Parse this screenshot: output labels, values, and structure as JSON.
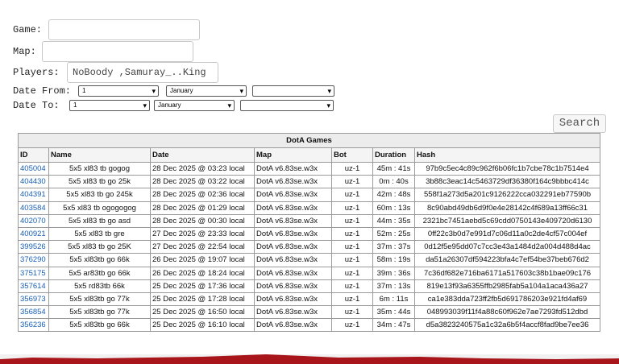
{
  "form": {
    "game_label": "Game:",
    "game_value": "",
    "map_label": "Map:",
    "map_value": "",
    "players_label": "Players:",
    "players_value": "NoBoody ,Samuray_..King",
    "date_from_label": "Date From:",
    "date_to_label": "Date To:",
    "from_day": "1",
    "from_month": "January",
    "from_year": "",
    "to_day": "1",
    "to_month": "January",
    "to_year": "",
    "search_label": "Search"
  },
  "table": {
    "title": "DotA Games",
    "headers": [
      "ID",
      "Name",
      "Date",
      "Map",
      "Bot",
      "Duration",
      "Hash"
    ],
    "rows": [
      [
        "405004",
        "5x5 xl83 tb gogog",
        "28 Dec 2025 @ 03:23 local",
        "DotA v6.83se.w3x",
        "uz-1",
        "45m : 41s",
        "97b9c5ec4c89c962f6b06fc1b7cbe78c1b7514e4"
      ],
      [
        "404430",
        "5x5 xl83 tb go 25k",
        "28 Dec 2025 @ 03:22 local",
        "DotA v6.83se.w3x",
        "uz-1",
        "0m : 40s",
        "3b88c3eac14c5463729df36380f164c9bbbc414c"
      ],
      [
        "404391",
        "5x5 xl83 tb go 245k",
        "28 Dec 2025 @ 02:36 local",
        "DotA v6.83se.w3x",
        "uz-1",
        "42m : 48s",
        "558f1a273d5a201c9126222cca032291eb77590b"
      ],
      [
        "403584",
        "5x5 xl83 tb ogogogog",
        "28 Dec 2025 @ 01:29 local",
        "DotA v6.83se.w3x",
        "uz-1",
        "60m : 13s",
        "8c90abd49db6d9f0e4e28142c4f689a13ff66c31"
      ],
      [
        "402070",
        "5x5 xl83 tb go asd",
        "28 Dec 2025 @ 00:30 local",
        "DotA v6.83se.w3x",
        "uz-1",
        "44m : 35s",
        "2321bc7451aebd5c69cdd0750143e409720d6130"
      ],
      [
        "400921",
        "5x5 xl83 tb gre",
        "27 Dec 2025 @ 23:33 local",
        "DotA v6.83se.w3x",
        "uz-1",
        "52m : 25s",
        "0ff22c3b0d7e991d7c06d11a0c2de4cf57c004ef"
      ],
      [
        "399526",
        "5x5 xl83 tb go 25K",
        "27 Dec 2025 @ 22:54 local",
        "DotA v6.83se.w3x",
        "uz-1",
        "37m : 37s",
        "0d12f5e95dd07c7cc3e43a1484d2a004d488d4ac"
      ],
      [
        "376290",
        "5x5 xl83tb go 66k",
        "26 Dec 2025 @ 19:07 local",
        "DotA v6.83se.w3x",
        "uz-1",
        "58m : 19s",
        "da51a26307df594223bfa4c7ef54be37beb676d2"
      ],
      [
        "375175",
        "5x5 ar83tb go 66k",
        "26 Dec 2025 @ 18:24 local",
        "DotA v6.83se.w3x",
        "uz-1",
        "39m : 36s",
        "7c36df682e716ba6171a517603c38b1bae09c176"
      ],
      [
        "357614",
        "5x5 rd83tb 66k",
        "25 Dec 2025 @ 17:36 local",
        "DotA v6.83se.w3x",
        "uz-1",
        "37m : 13s",
        "819e13f93a6355ffb2985fab5a104a1aca436a27"
      ],
      [
        "356973",
        "5x5 xl83tb go 77k",
        "25 Dec 2025 @ 17:28 local",
        "DotA v6.83se.w3x",
        "uz-1",
        "6m : 11s",
        "ca1e383dda723ff2fb5d691786203e921fd4af69"
      ],
      [
        "356854",
        "5x5 xl83tb go 77k",
        "25 Dec 2025 @ 16:50 local",
        "DotA v6.83se.w3x",
        "uz-1",
        "35m : 44s",
        "048993039f11f4a88c60f962e7ae7293fd512dbd"
      ],
      [
        "356236",
        "5x5 xl83tb go 66k",
        "25 Dec 2025 @ 16:10 local",
        "DotA v6.83se.w3x",
        "uz-1",
        "34m : 47s",
        "d5a3823240575a1c32a6b5f4accf8fad9be7ee36"
      ]
    ]
  },
  "colors": {
    "link": "#1a5fb4",
    "footer_band": "#a8151a"
  }
}
